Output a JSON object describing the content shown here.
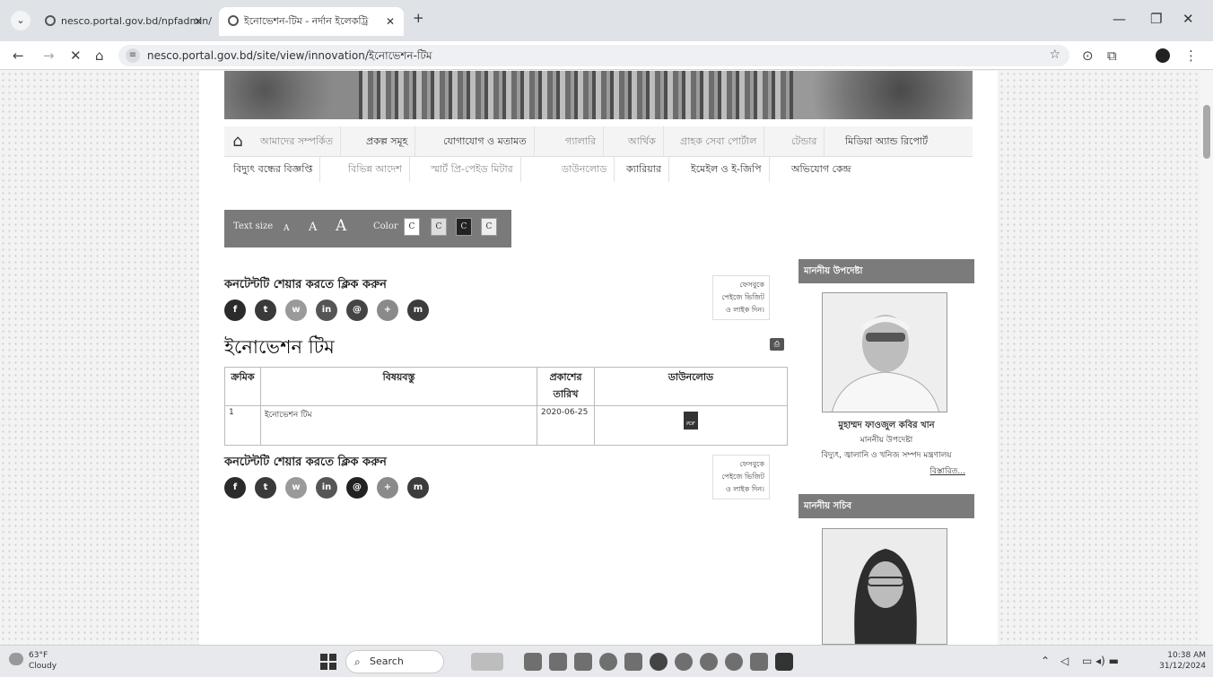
{
  "browser": {
    "tabs": [
      {
        "title": "nesco.portal.gov.bd/npfadmin/"
      },
      {
        "title": "ইনোভেশন-টিম - নর্দান ইলেকট্রি"
      }
    ],
    "new_tab": "+",
    "url": "nesco.portal.gov.bd/site/view/innovation/ইনোভেশন-টিম"
  },
  "nav": {
    "row1": [
      "আমাদের সম্পর্কিত",
      "প্রকল্প সমূহ",
      "যোগাযোগ ও মতামত",
      "গ্যালারি",
      "আর্থিক",
      "গ্রাহক সেবা পোর্টাল",
      "টেন্ডার",
      "মিডিয়া অ্যান্ড রিপোর্ট"
    ],
    "row2": [
      "বিদ্যুৎ বন্ধের বিজ্ঞপ্তি",
      "বিভিন্ন আদেশ",
      "স্মার্ট প্রি-পেইড মিটার",
      "ডাউনলোড",
      "ক্যারিয়ার",
      "ইমেইল ও ই-জিপি",
      "অভিযোগ কেন্দ্র"
    ]
  },
  "textsize": {
    "label": "Text size",
    "sizes": [
      "A",
      "A",
      "A"
    ],
    "color_label": "Color",
    "color_buttons": [
      "C",
      "C",
      "C",
      "C"
    ]
  },
  "share": {
    "title": "কনটেন্টটি শেয়ার করতে ক্লিক করুন",
    "facebook_note": "ফেসবুকে পেইজে ভিজিট ও লাইক দিন।",
    "icons": [
      "f",
      "t",
      "w",
      "in",
      "@",
      "+",
      "m"
    ]
  },
  "page_title": "ইনোভেশন টিম",
  "table": {
    "headers": [
      "ক্রমিক",
      "বিষয়বস্তু",
      "প্রকাশের তারিখ",
      "ডাউনলোড"
    ],
    "rows": [
      {
        "serial": "1",
        "subject": "ইনোভেশন টিম",
        "date": "2020-06-25",
        "file": "PDF"
      }
    ]
  },
  "sidebar": {
    "advisor_heading": "মাননীয় উপদেষ্টা",
    "advisor_name": "মুহাম্মদ ফাওজুল কবির খান",
    "advisor_role": "মাননীয় উপদেষ্টা",
    "advisor_ministry": "বিদ্যুৎ, জ্বালানি ও খনিজ সম্পদ মন্ত্রণালয়",
    "details_link": "বিস্তারিত...",
    "secretary_heading": "মাননীয় সচিব"
  },
  "taskbar": {
    "temp": "63°F",
    "weather": "Cloudy",
    "search": "Search",
    "time": "10:38 AM",
    "date": "31/12/2024"
  }
}
